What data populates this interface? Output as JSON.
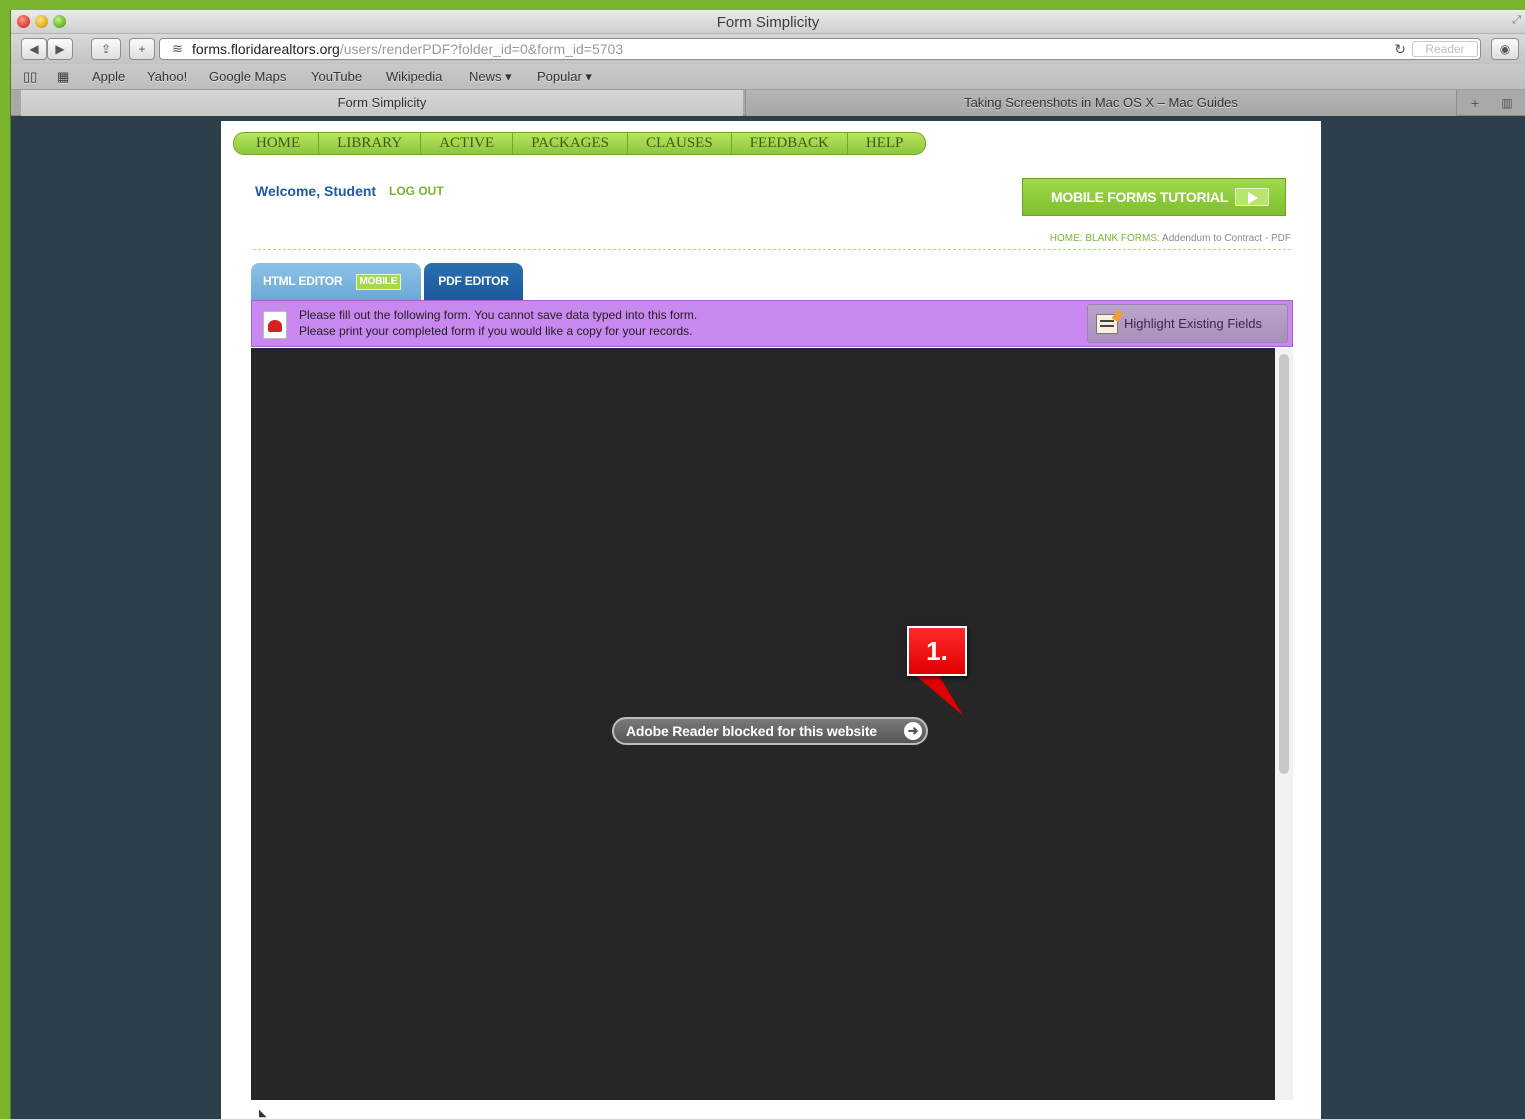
{
  "window": {
    "title": "Form Simplicity",
    "colors": {
      "frame": "#7ab32e",
      "page_bg": "#2e3f4c"
    }
  },
  "toolbar": {
    "back_icon": "back-arrow-icon",
    "forward_icon": "forward-arrow-icon",
    "share_icon": "share-icon",
    "add_icon": "plus-icon",
    "url_host": "forms.floridarealtors.org",
    "url_path": "/users/renderPDF?folder_id=0&form_id=5703",
    "reload_icon": "reload-icon",
    "reader_label": "Reader",
    "download_icon": "download-icon"
  },
  "bookmarks": {
    "items": [
      "Apple",
      "Yahoo!",
      "Google Maps",
      "YouTube",
      "Wikipedia",
      "News ▾",
      "Popular ▾"
    ]
  },
  "tabs": [
    {
      "label": "Form Simplicity",
      "active": true
    },
    {
      "label": "Taking Screenshots in Mac OS X – Mac Guides",
      "active": false
    }
  ],
  "nav": {
    "items": [
      "HOME",
      "LIBRARY",
      "ACTIVE",
      "PACKAGES",
      "CLAUSES",
      "FEEDBACK",
      "HELP"
    ]
  },
  "user": {
    "welcome": "Welcome, Student",
    "logout": "LOG OUT"
  },
  "tutorial": {
    "label": "MOBILE FORMS TUTORIAL"
  },
  "breadcrumb": {
    "home": "HOME",
    "sep": ":",
    "blank_forms": "BLANK FORMS",
    "current": "Addendum to Contract - PDF"
  },
  "editor_tabs": {
    "html_label": "HTML EDITOR",
    "mobile_badge": "MOBILE",
    "pdf_label": "PDF EDITOR"
  },
  "infobar": {
    "line1": "Please fill out the following form. You cannot save data typed into this form.",
    "line2": "Please print your completed form if you would like a copy for your records.",
    "highlight_label": "Highlight Existing Fields"
  },
  "viewer": {
    "blocked_message": "Adobe Reader blocked for this website"
  },
  "annotation": {
    "label": "1."
  }
}
